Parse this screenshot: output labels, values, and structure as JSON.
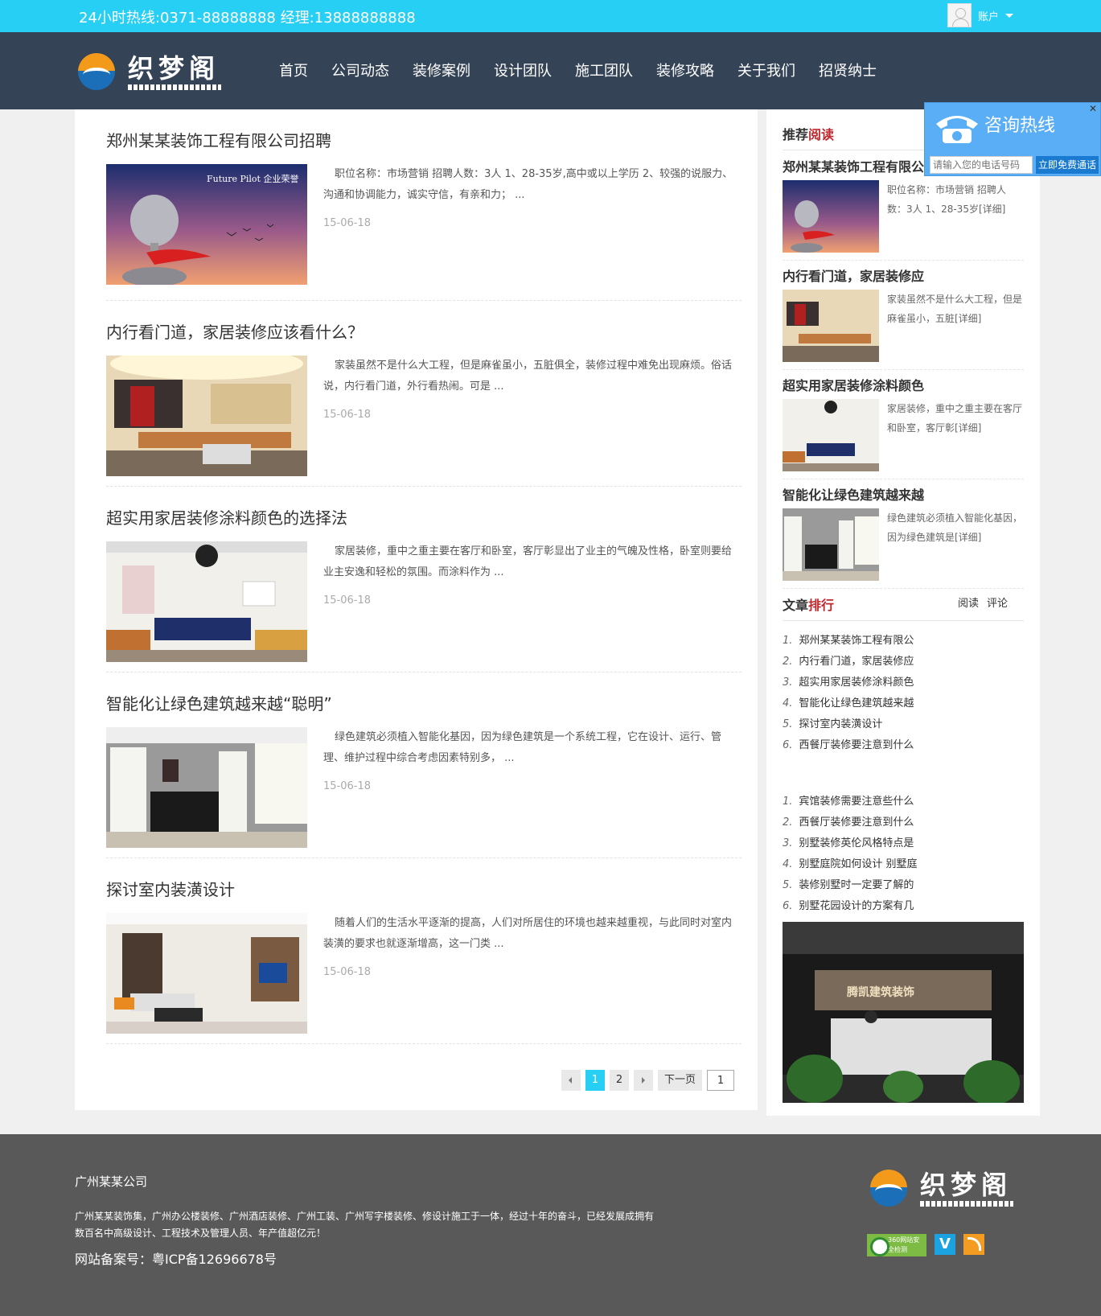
{
  "topbar": {
    "hotline": "24小时热线:0371-88888888 经理:13888888888",
    "account_label": "账户"
  },
  "header": {
    "logo_text": "织梦阁"
  },
  "nav": [
    "首页",
    "公司动态",
    "装修案例",
    "设计团队",
    "施工团队",
    "装修攻略",
    "关于我们",
    "招贤纳士"
  ],
  "articles": [
    {
      "title": "郑州某某装饰工程有限公司招聘",
      "summary": "职位名称：市场营销 招聘人数：3人 1、28-35岁,高中或以上学历 2、较强的说服力、沟通和协调能力，诚实守信，有亲和力； ...",
      "date": "15-06-18",
      "thumb_text": "Future Pilot 企业荣誉"
    },
    {
      "title": "内行看门道，家居装修应该看什么？",
      "summary": "家装虽然不是什么大工程，但是麻雀虽小，五脏俱全，装修过程中难免出现麻烦。俗话说，内行看门道，外行看热闹。可是 ...",
      "date": "15-06-18"
    },
    {
      "title": "超实用家居装修涂料颜色的选择法",
      "summary": "家居装修，重中之重主要在客厅和卧室，客厅彰显出了业主的气魄及性格，卧室则要给业主安逸和轻松的氛围。而涂料作为 ...",
      "date": "15-06-18"
    },
    {
      "title": "智能化让绿色建筑越来越“聪明”",
      "summary": "绿色建筑必须植入智能化基因，因为绿色建筑是一个系统工程，它在设计、运行、管理、维护过程中综合考虑因素特别多， ...",
      "date": "15-06-18"
    },
    {
      "title": "探讨室内装潢设计",
      "summary": "随着人们的生活水平逐渐的提高，人们对所居住的环境也越来越重视，与此同时对室内装潢的要求也就逐渐增高，这一门类 ...",
      "date": "15-06-18"
    }
  ],
  "pager": {
    "current": "1",
    "page2": "2",
    "next": "下一页",
    "select": "1"
  },
  "sidebar": {
    "recommend_head_a": "推荐",
    "recommend_head_b": "阅读",
    "recommend": [
      {
        "title": "郑州某某装饰工程有限公司招聘",
        "text": "职位名称：市场营销 招聘人数：3人 1、28-35岁[详细]"
      },
      {
        "title": "内行看门道，家居装修应",
        "text": "家装虽然不是什么大工程，但是麻雀虽小，五脏[详细]"
      },
      {
        "title": "超实用家居装修涂料颜色",
        "text": "家居装修，重中之重主要在客厅和卧室，客厅彰[详细]"
      },
      {
        "title": "智能化让绿色建筑越来越",
        "text": "绿色建筑必须植入智能化基因，因为绿色建筑是[详细]"
      }
    ],
    "rank_head_a": "文章",
    "rank_head_b": "排行",
    "rank_tabs": [
      "阅读",
      "评论"
    ],
    "rank_read": [
      "郑州某某装饰工程有限公",
      "内行看门道，家居装修应",
      "超实用家居装修涂料颜色",
      "智能化让绿色建筑越来越",
      "探讨室内装潢设计",
      "西餐厅装修要注意到什么"
    ],
    "rank_comment": [
      "宾馆装修需要注意些什么",
      "西餐厅装修要注意到什么",
      "别墅装修英伦风格特点是",
      "别墅庭院如何设计 别墅庭",
      "装修别墅时一定要了解的",
      "别墅花园设计的方案有几"
    ],
    "ad_sign_text": "腾凯建筑装饰"
  },
  "hotline_float": {
    "title": "咨询热线",
    "placeholder": "请输入您的电话号码",
    "button": "立即免费通话",
    "close": "✕"
  },
  "footer": {
    "company": "广州某某公司",
    "description": "广州某某装饰集，广州办公楼装修、广州酒店装修、广州工装、广州写字楼装修、修设计施工于一体，经过十年的奋斗，已经发展成拥有数百名中高级设计、工程技术及管理人员、年产值超亿元！",
    "icp": "网站备案号：粤ICP备12696678号",
    "logo_text": "织梦阁",
    "badge_360_text": "360网站安全检测",
    "badge_v_text": "V"
  },
  "colors": {
    "topbar": "#27cff5",
    "header": "#344356",
    "accent_red": "#c0272d",
    "footer": "#595959"
  }
}
